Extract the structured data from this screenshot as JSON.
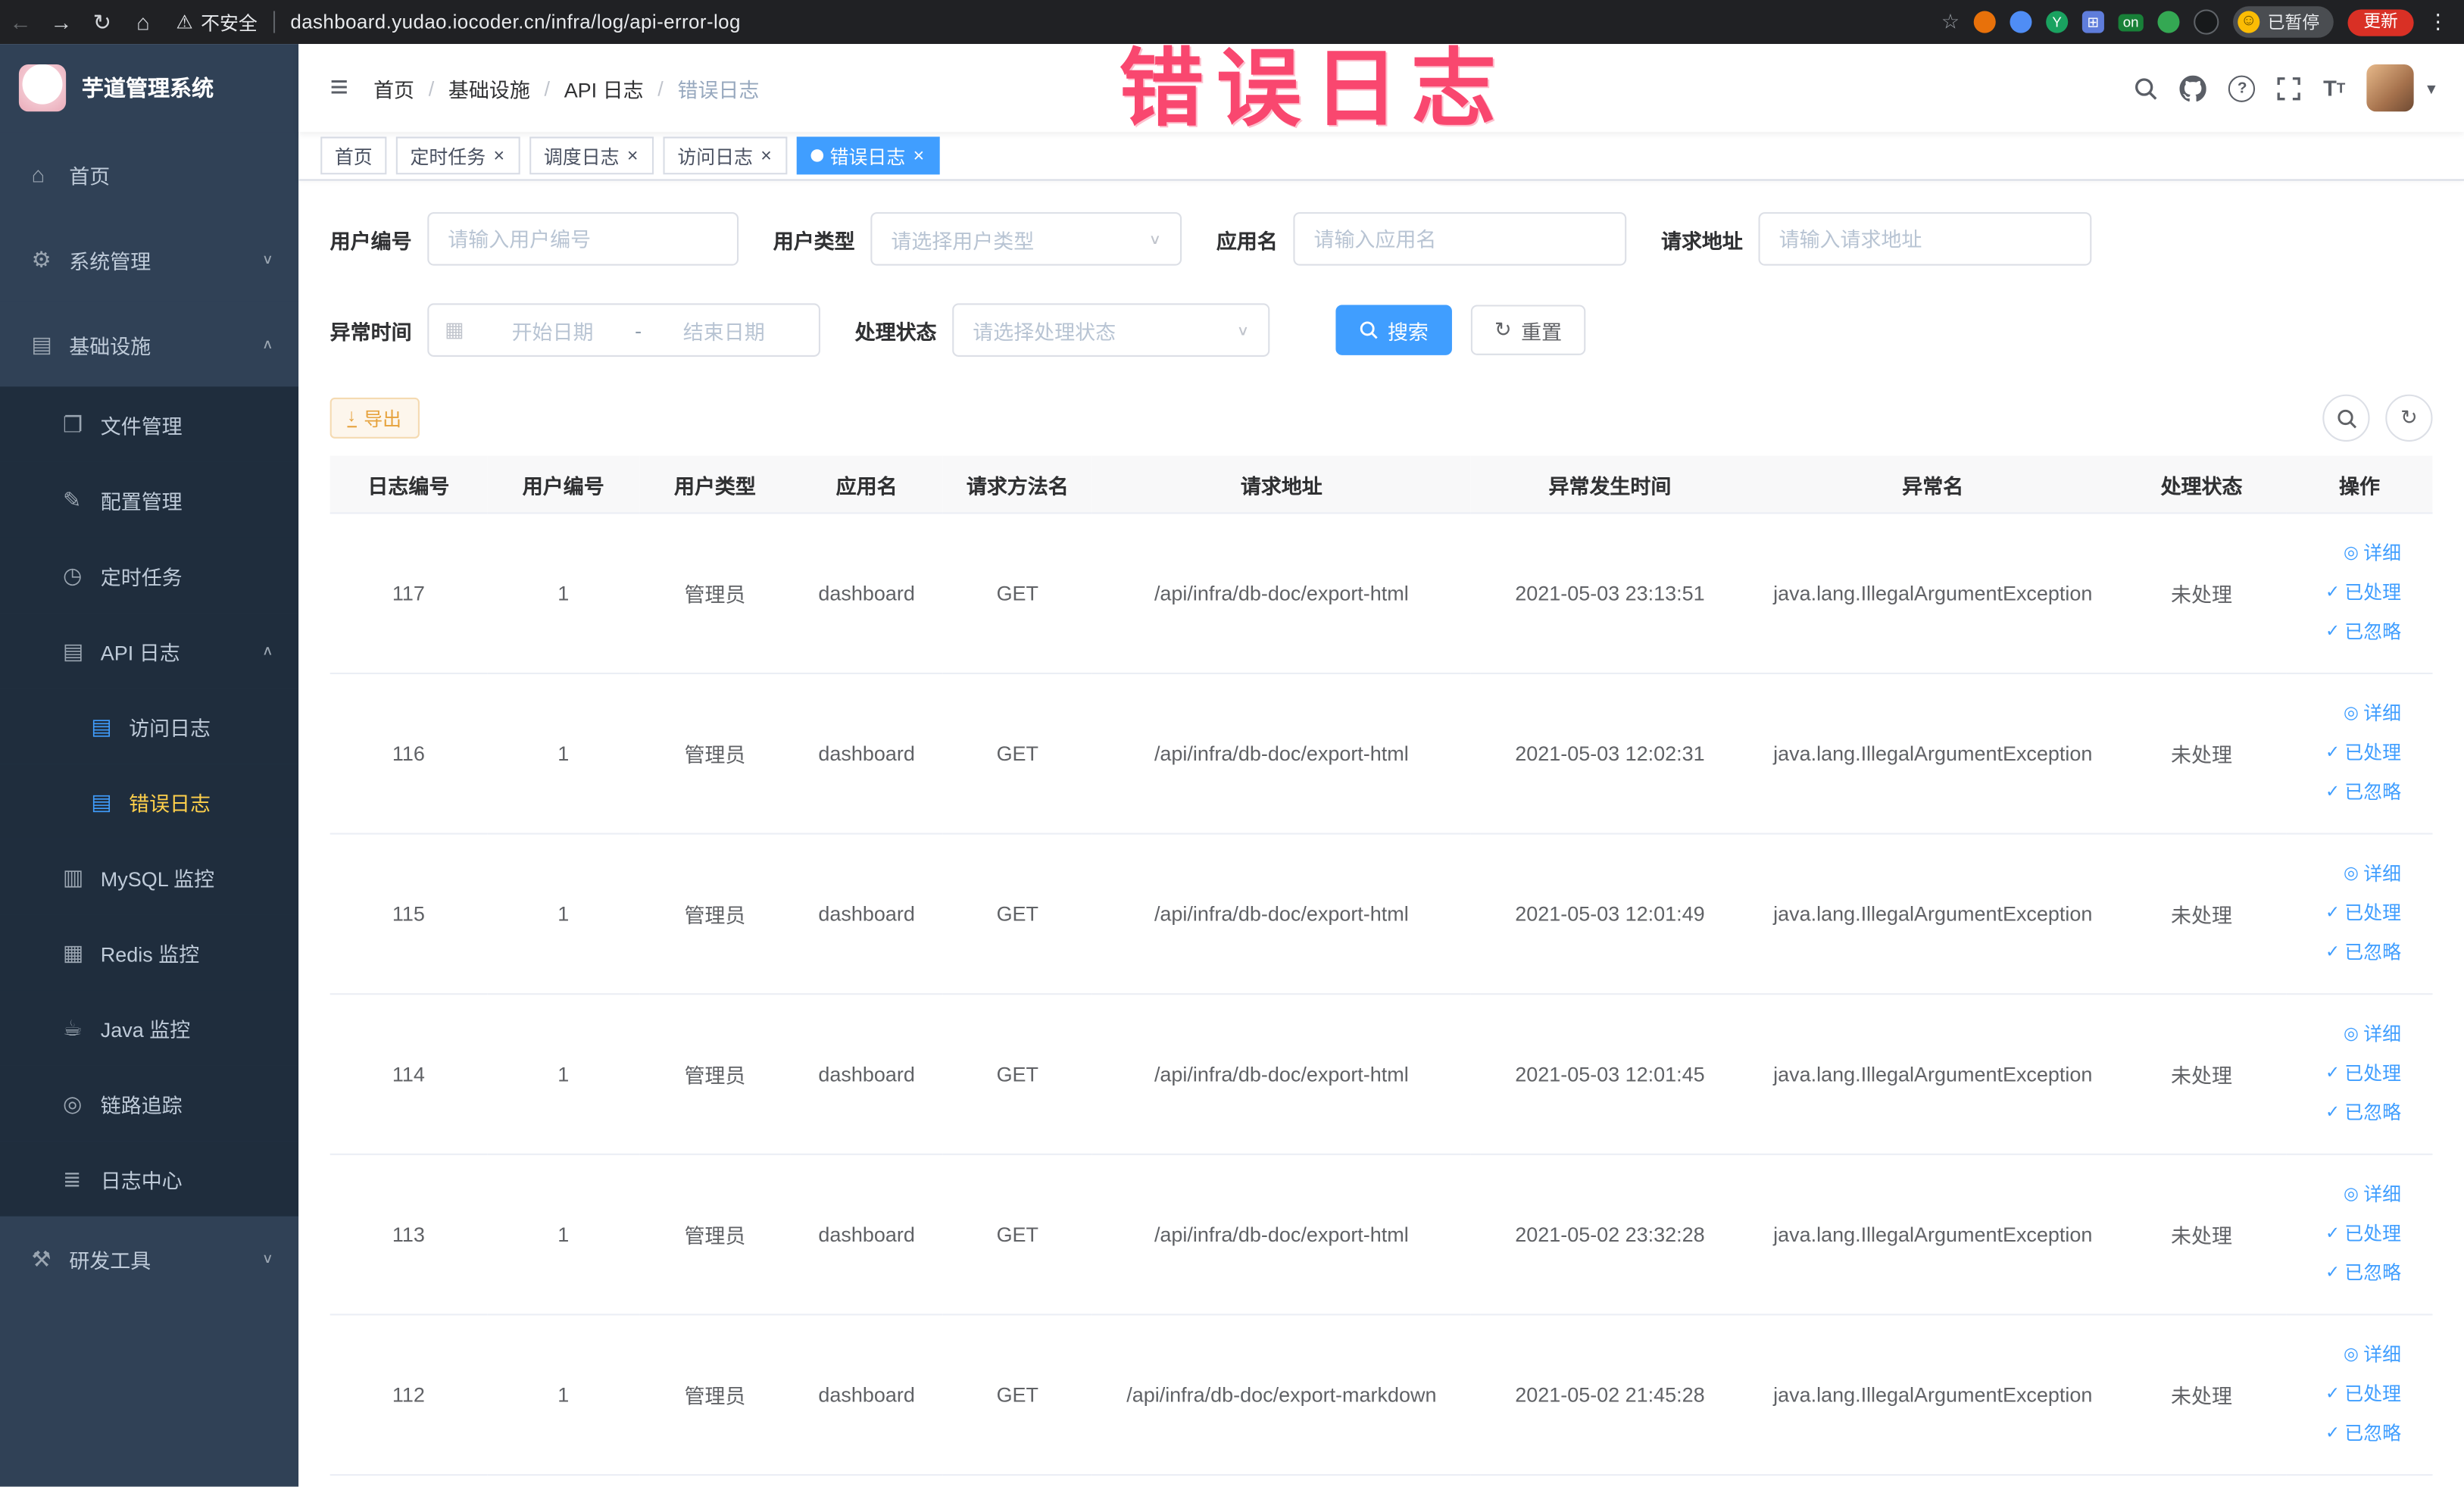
{
  "colors": {
    "accent": "#409EFF",
    "sidebar_bg": "#304156",
    "submenu_bg": "#1f2d3d",
    "active_menu_text": "#ffd04b",
    "annotation": "#f9476f",
    "warning_button_text": "#e6a23c"
  },
  "browser": {
    "security_label": "不安全",
    "url": "dashboard.yudao.iocoder.cn/infra/log/api-error-log",
    "on_badge": "on",
    "paused_label": "已暂停",
    "update_label": "更新"
  },
  "annotation": {
    "text": "错误日志",
    "color": "#f9476f"
  },
  "sidebar": {
    "title": "芋道管理系统",
    "items": [
      {
        "id": "home",
        "label": "首页",
        "icon": "home-icon",
        "level": 1
      },
      {
        "id": "system-management",
        "label": "系统管理",
        "icon": "gear-icon",
        "level": 1,
        "arrow": "down"
      },
      {
        "id": "infrastructure",
        "label": "基础设施",
        "icon": "infra-icon",
        "level": 1,
        "arrow": "up"
      },
      {
        "id": "file-management",
        "label": "文件管理",
        "icon": "file-icon",
        "level": 2
      },
      {
        "id": "config-management",
        "label": "配置管理",
        "icon": "config-icon",
        "level": 2
      },
      {
        "id": "scheduled-jobs",
        "label": "定时任务",
        "icon": "job-icon",
        "level": 2
      },
      {
        "id": "api-log",
        "label": "API 日志",
        "icon": "api-log-icon",
        "level": 2,
        "arrow": "up"
      },
      {
        "id": "access-log",
        "label": "访问日志",
        "icon": "access-log-icon",
        "level": 3
      },
      {
        "id": "error-log",
        "label": "错误日志",
        "icon": "error-log-icon",
        "level": 3,
        "active": true
      },
      {
        "id": "mysql-monitor",
        "label": "MySQL 监控",
        "icon": "mysql-icon",
        "level": 2
      },
      {
        "id": "redis-monitor",
        "label": "Redis 监控",
        "icon": "redis-icon",
        "level": 2
      },
      {
        "id": "java-monitor",
        "label": "Java 监控",
        "icon": "java-icon",
        "level": 2
      },
      {
        "id": "link-trace",
        "label": "链路追踪",
        "icon": "trace-icon",
        "level": 2
      },
      {
        "id": "log-center",
        "label": "日志中心",
        "icon": "log-center-icon",
        "level": 2
      },
      {
        "id": "dev-tools",
        "label": "研发工具",
        "icon": "tools-icon",
        "level": 1,
        "arrow": "down"
      }
    ]
  },
  "breadcrumb": [
    "首页",
    "基础设施",
    "API 日志",
    "错误日志"
  ],
  "tabs": [
    {
      "id": "home",
      "label": "首页",
      "closable": false,
      "active": false
    },
    {
      "id": "scheduled-jobs",
      "label": "定时任务",
      "closable": true,
      "active": false
    },
    {
      "id": "job-log",
      "label": "调度日志",
      "closable": true,
      "active": false
    },
    {
      "id": "access-log",
      "label": "访问日志",
      "closable": true,
      "active": false
    },
    {
      "id": "error-log",
      "label": "错误日志",
      "closable": true,
      "active": true
    }
  ],
  "filters": {
    "user_id": {
      "label": "用户编号",
      "placeholder": "请输入用户编号"
    },
    "user_type": {
      "label": "用户类型",
      "placeholder": "请选择用户类型"
    },
    "app_name": {
      "label": "应用名",
      "placeholder": "请输入应用名"
    },
    "request_url": {
      "label": "请求地址",
      "placeholder": "请输入请求地址"
    },
    "exception_time": {
      "label": "异常时间",
      "start_placeholder": "开始日期",
      "separator": "-",
      "end_placeholder": "结束日期"
    },
    "process_status": {
      "label": "处理状态",
      "placeholder": "请选择处理状态"
    },
    "search_button": "搜索",
    "reset_button": "重置"
  },
  "toolbar": {
    "export_label": "导出"
  },
  "table": {
    "headers": [
      "日志编号",
      "用户编号",
      "用户类型",
      "应用名",
      "请求方法名",
      "请求地址",
      "异常发生时间",
      "异常名",
      "处理状态",
      "操作"
    ],
    "actions": [
      {
        "id": "detail",
        "label": "详细"
      },
      {
        "id": "processed",
        "label": "已处理"
      },
      {
        "id": "ignored",
        "label": "已忽略"
      }
    ],
    "rows": [
      {
        "id": "117",
        "user_id": "1",
        "user_type": "管理员",
        "app": "dashboard",
        "method": "GET",
        "url": "/api/infra/db-doc/export-html",
        "time": "2021-05-03 23:13:51",
        "exception": "java.lang.IllegalArgumentException",
        "status": "未处理"
      },
      {
        "id": "116",
        "user_id": "1",
        "user_type": "管理员",
        "app": "dashboard",
        "method": "GET",
        "url": "/api/infra/db-doc/export-html",
        "time": "2021-05-03 12:02:31",
        "exception": "java.lang.IllegalArgumentException",
        "status": "未处理"
      },
      {
        "id": "115",
        "user_id": "1",
        "user_type": "管理员",
        "app": "dashboard",
        "method": "GET",
        "url": "/api/infra/db-doc/export-html",
        "time": "2021-05-03 12:01:49",
        "exception": "java.lang.IllegalArgumentException",
        "status": "未处理"
      },
      {
        "id": "114",
        "user_id": "1",
        "user_type": "管理员",
        "app": "dashboard",
        "method": "GET",
        "url": "/api/infra/db-doc/export-html",
        "time": "2021-05-03 12:01:45",
        "exception": "java.lang.IllegalArgumentException",
        "status": "未处理"
      },
      {
        "id": "113",
        "user_id": "1",
        "user_type": "管理员",
        "app": "dashboard",
        "method": "GET",
        "url": "/api/infra/db-doc/export-html",
        "time": "2021-05-02 23:32:28",
        "exception": "java.lang.IllegalArgumentException",
        "status": "未处理"
      },
      {
        "id": "112",
        "user_id": "1",
        "user_type": "管理员",
        "app": "dashboard",
        "method": "GET",
        "url": "/api/infra/db-doc/export-markdown",
        "time": "2021-05-02 21:45:28",
        "exception": "java.lang.IllegalArgumentException",
        "status": "未处理"
      }
    ]
  }
}
